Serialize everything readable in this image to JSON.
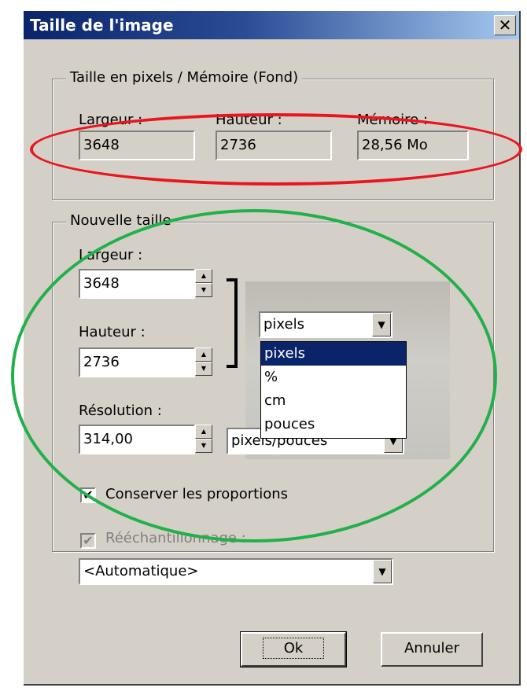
{
  "window": {
    "title": "Taille de l'image",
    "close_glyph": "✕"
  },
  "pixel_group": {
    "legend": "Taille en pixels / Mémoire (Fond)",
    "width_label": "Largeur :",
    "width_value": "3648",
    "height_label": "Hauteur :",
    "height_value": "2736",
    "memory_label": "Mémoire :",
    "memory_value": "28,56 Mo"
  },
  "new_size": {
    "legend": "Nouvelle taille",
    "width_label": "Largeur :",
    "width_value": "3648",
    "height_label": "Hauteur :",
    "height_value": "2736",
    "unit_selected": "pixels",
    "unit_options": [
      "pixels",
      "%",
      "cm",
      "pouces"
    ],
    "resolution_label": "Résolution :",
    "resolution_value": "314,00",
    "resolution_unit": "pixels/pouces",
    "keep_proportions_label": "Conserver les proportions",
    "keep_proportions_checked": true,
    "resample_label": "Rééchantillonnage :",
    "resample_checked": true,
    "resample_value": "<Automatique>"
  },
  "buttons": {
    "ok": "Ok",
    "cancel": "Annuler"
  },
  "annotations": {
    "red_color": "#e8161f",
    "green_color": "#22b04a"
  },
  "icons": {
    "close": "close-icon",
    "spin_up": "▲",
    "spin_down": "▼",
    "dropdown": "▼",
    "check": "✔"
  }
}
